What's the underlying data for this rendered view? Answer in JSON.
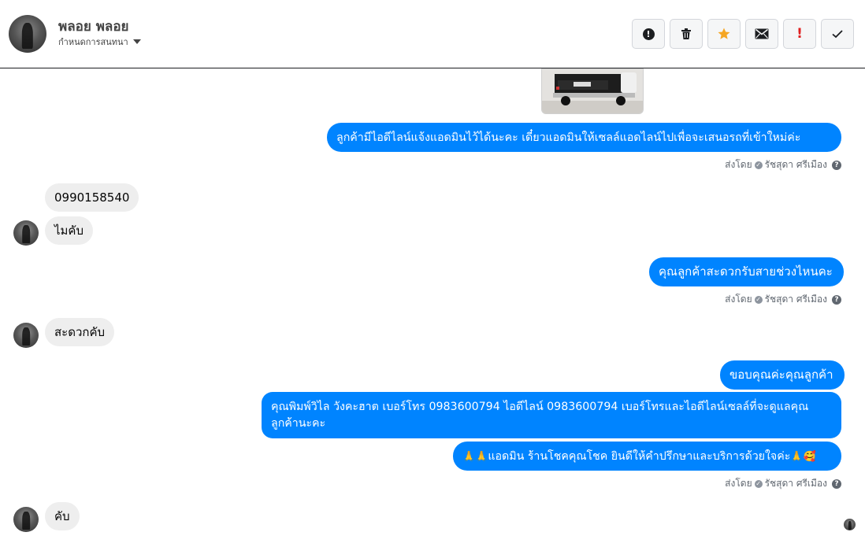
{
  "header": {
    "contact_name": "พลอย พลอย",
    "assign_label": "กำหนดการสนทนา",
    "toolbar": [
      {
        "name": "info-icon",
        "glyph": "!"
      },
      {
        "name": "trash-icon",
        "glyph": "🗑"
      },
      {
        "name": "star-icon",
        "glyph": "★"
      },
      {
        "name": "envelope-icon",
        "glyph": "✉"
      },
      {
        "name": "exclamation-icon",
        "glyph": "!"
      },
      {
        "name": "checkmark-icon",
        "glyph": "✓"
      }
    ]
  },
  "messages": {
    "out_1": "ลูกค้ามีไอดีไลน์แจ้งแอดมินไว้ได้นะคะ เดี๋ยวแอดมินให้เซลล์แอดไลน์ไปเพื่อจะเสนอรถที่เข้าใหม่ค่ะ",
    "sent_by_prefix": "ส่งโดย",
    "sent_by_name": "รัชสุดา ศรีเมือง",
    "in_phone": "0990158540",
    "in_no": "ไมคับ",
    "out_2": "คุณลูกค้าสะดวกรับสายช่วงไหนคะ",
    "in_convenient": "สะดวกคับ",
    "out_3": "ขอบคุณค่ะคุณลูกค้า",
    "out_4": "คุณพิมพ์วิไล วังคะฮาต   เบอร์โทร 0983600794  ไอดีไลน์ 0983600794   เบอร์โทรและไอดีไลน์เซลล์ที่จะดูแลคุณลูกค้านะคะ",
    "out_5_prefix": "🙏🙏",
    "out_5_text": "แอดมิน ร้านโชคคุณโชค ยินดีให้คำปรึกษาและบริการด้วยใจค่ะ",
    "out_5_suffix": "🙏🥰",
    "in_yes": "คับ"
  },
  "colors": {
    "outgoing_bubble": "#0084ff",
    "incoming_bubble": "#eeeeee",
    "star": "#f5a623",
    "alert": "#e02020"
  }
}
